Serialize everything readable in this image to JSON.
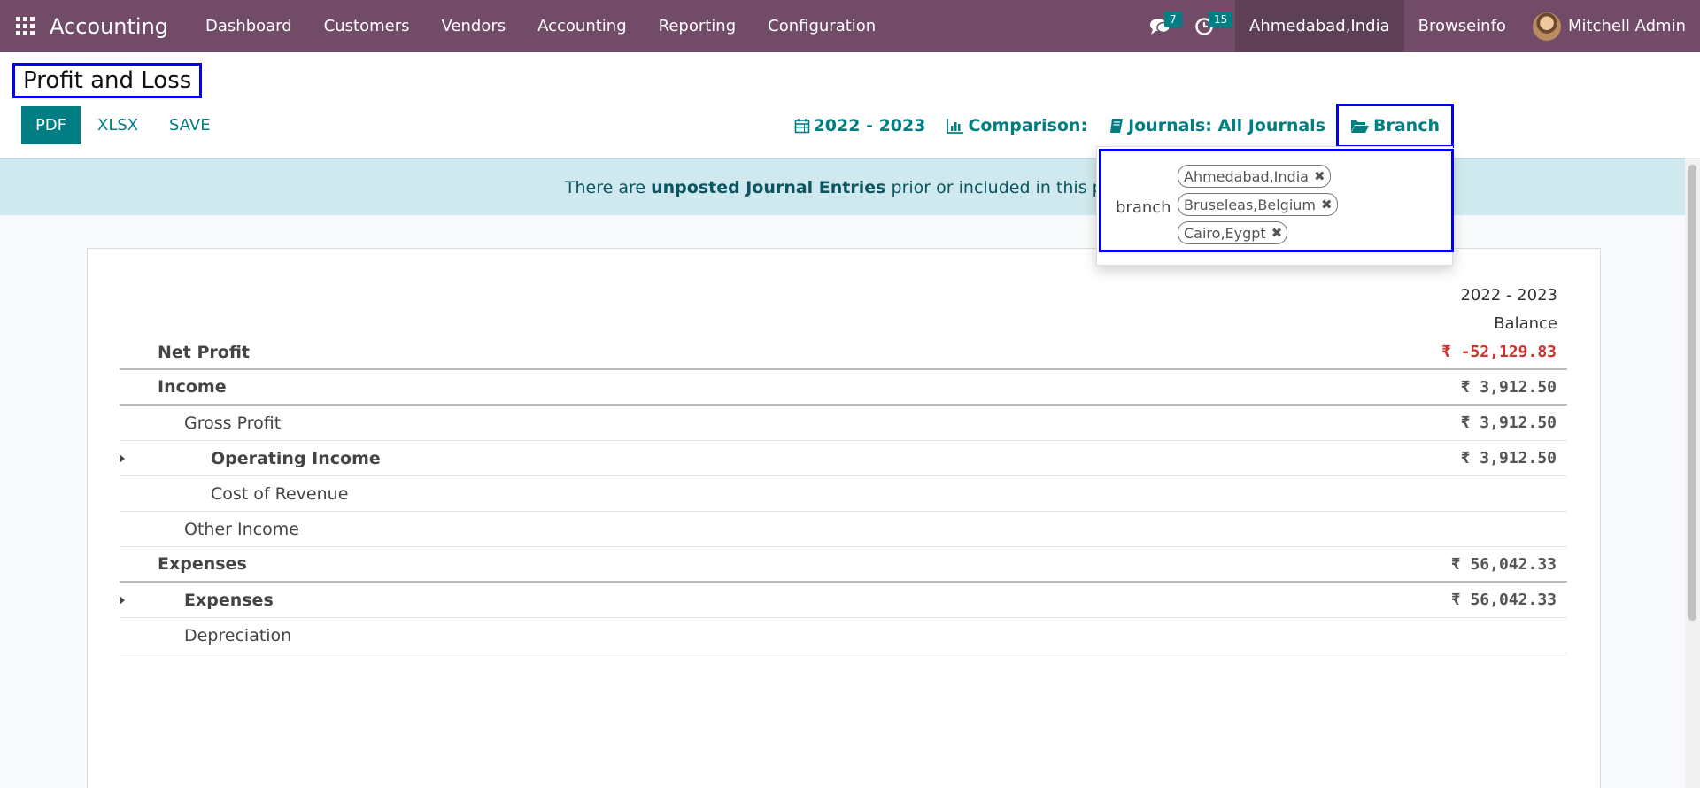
{
  "app": {
    "name": "Accounting"
  },
  "nav": {
    "items": [
      {
        "label": "Dashboard"
      },
      {
        "label": "Customers"
      },
      {
        "label": "Vendors"
      },
      {
        "label": "Accounting"
      },
      {
        "label": "Reporting"
      },
      {
        "label": "Configuration"
      }
    ],
    "messages_count": "7",
    "activities_count": "15",
    "current_company": "Ahmedabad,India",
    "company2": "Browseinfo",
    "user_name": "Mitchell Admin"
  },
  "page": {
    "title": "Profit and Loss",
    "buttons": {
      "pdf": "PDF",
      "xlsx": "XLSX",
      "save": "SAVE"
    }
  },
  "filters": {
    "date": "2022 - 2023",
    "comparison": "Comparison:",
    "journals": "Journals: All Journals",
    "branch": "Branch"
  },
  "alert": {
    "prefix": "There are ",
    "strong": "unposted Journal Entries",
    "suffix": " prior or included in this perio"
  },
  "branch_dropdown": {
    "label": "branch",
    "tags": [
      "Ahmedabad,India",
      "Bruseleas,Belgium",
      "Cairo,Eygpt"
    ]
  },
  "report": {
    "period": "2022 - 2023",
    "column": "Balance",
    "rows": [
      {
        "label": "Net Profit",
        "value": "₹ -52,129.83"
      },
      {
        "label": "Income",
        "value": "₹ 3,912.50"
      },
      {
        "label": "Gross Profit",
        "value": "₹ 3,912.50"
      },
      {
        "label": "Operating Income",
        "value": "₹ 3,912.50"
      },
      {
        "label": "Cost of Revenue",
        "value": ""
      },
      {
        "label": "Other Income",
        "value": ""
      },
      {
        "label": "Expenses",
        "value": "₹ 56,042.33"
      },
      {
        "label": "Expenses",
        "value": "₹ 56,042.33"
      },
      {
        "label": "Depreciation",
        "value": ""
      }
    ]
  },
  "colors": {
    "navbar": "#714b67",
    "accent": "#017e84",
    "negative": "#d0312d",
    "highlight_border": "#0000ff"
  }
}
